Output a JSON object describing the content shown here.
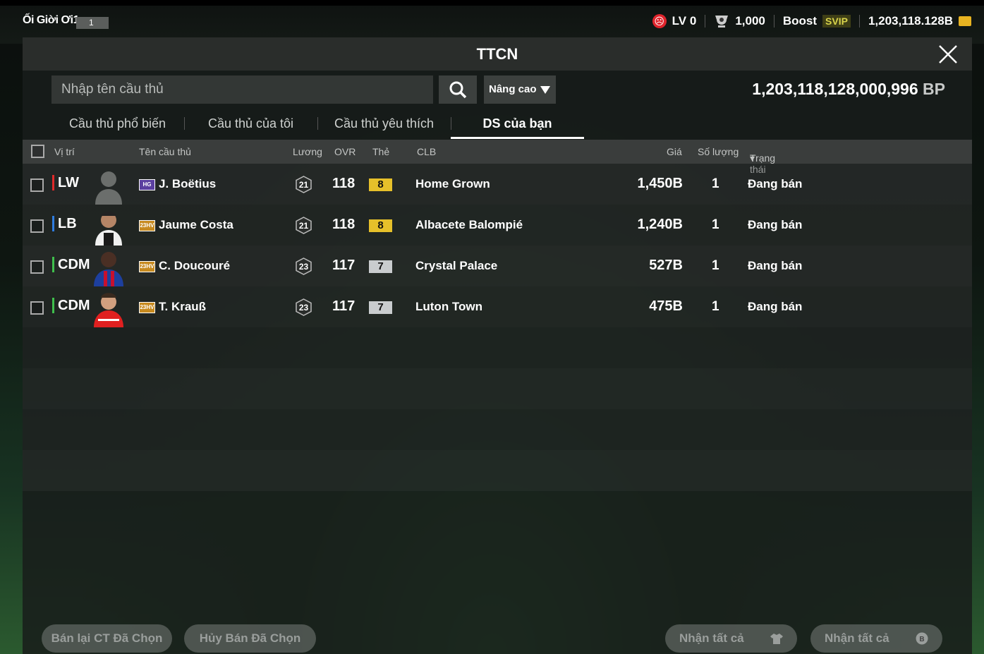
{
  "topbar": {
    "username": "Ối Giời Ơi1",
    "badge_num": "1",
    "level": "LV 0",
    "trophies": "1,000",
    "boost": "Boost",
    "svip": "SVIP",
    "coins": "1,203,118.128B"
  },
  "panel": {
    "title": "TTCN",
    "search_placeholder": "Nhập tên cầu thủ",
    "advanced": "Nâng cao",
    "bp_amount": "1,203,118,128,000,996",
    "bp_unit": "BP"
  },
  "tabs": [
    "Cầu thủ phổ biến",
    "Cầu thủ của tôi",
    "Cầu thủ yêu thích",
    "DS của bạn"
  ],
  "columns": {
    "position": "Vị trí",
    "name": "Tên cầu thủ",
    "wage": "Lương",
    "ovr": "OVR",
    "card": "Thẻ",
    "club": "CLB",
    "price": "Giá",
    "quantity": "Số lượng",
    "status": "Trạng thái"
  },
  "rows": [
    {
      "position": "LW",
      "pos_color": "#e02a2a",
      "season": "HG",
      "name": "J. Boëtius",
      "wage": "21",
      "ovr": "118",
      "grade": "8",
      "club": "Home Grown",
      "price": "1,450B",
      "qty": "1",
      "status": "Đang bán"
    },
    {
      "position": "LB",
      "pos_color": "#2f7de0",
      "season": "23HV",
      "name": "Jaume Costa",
      "wage": "21",
      "ovr": "118",
      "grade": "8",
      "club": "Albacete Balompié",
      "price": "1,240B",
      "qty": "1",
      "status": "Đang bán"
    },
    {
      "position": "CDM",
      "pos_color": "#3fbf4c",
      "season": "23HV",
      "name": "C. Doucouré",
      "wage": "23",
      "ovr": "117",
      "grade": "7",
      "club": "Crystal Palace",
      "price": "527B",
      "qty": "1",
      "status": "Đang bán"
    },
    {
      "position": "CDM",
      "pos_color": "#3fbf4c",
      "season": "23HV",
      "name": "T. Krauß",
      "wage": "23",
      "ovr": "117",
      "grade": "7",
      "club": "Luton Town",
      "price": "475B",
      "qty": "1",
      "status": "Đang bán"
    }
  ],
  "buttons": {
    "resell": "Bán lại CT Đã Chọn",
    "cancel": "Hủy Bán Đã Chọn",
    "claim_all_1": "Nhận tất cả",
    "claim_all_2": "Nhận tất cả"
  }
}
